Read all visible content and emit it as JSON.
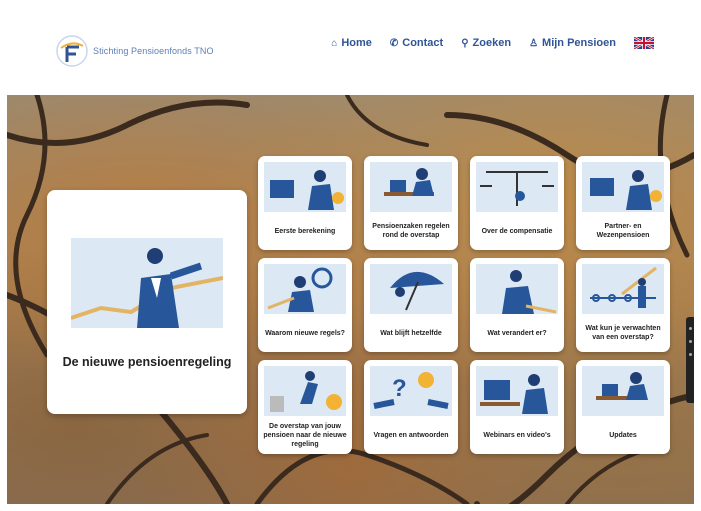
{
  "header": {
    "logo_text": "Stichting Pensioenfonds TNO",
    "nav": [
      {
        "label": "Home",
        "icon": "home-icon"
      },
      {
        "label": "Contact",
        "icon": "phone-icon"
      },
      {
        "label": "Zoeken",
        "icon": "search-icon"
      },
      {
        "label": "Mijn Pensioen",
        "icon": "user-icon"
      }
    ],
    "language_flag": "uk-flag-icon"
  },
  "feature": {
    "title": "De nieuwe pensioenregeling"
  },
  "tiles": [
    {
      "label": "Eerste berekening"
    },
    {
      "label": "Pensioenzaken regelen rond de overstap"
    },
    {
      "label": "Over de compensatie"
    },
    {
      "label": "Partner- en Wezenpensioen"
    },
    {
      "label": "Waarom nieuwe regels?"
    },
    {
      "label": "Wat blijft hetzelfde"
    },
    {
      "label": "Wat verandert er?"
    },
    {
      "label": "Wat kun je verwachten van een overstap?"
    },
    {
      "label": "De overstap van jouw pensioen naar de nieuwe regeling"
    },
    {
      "label": "Vragen en antwoorden"
    },
    {
      "label": "Webinars en video's"
    },
    {
      "label": "Updates"
    }
  ],
  "colors": {
    "brand": "#2f5597",
    "accent": "#f2b233",
    "illustration_bg": "#dce8f4"
  }
}
